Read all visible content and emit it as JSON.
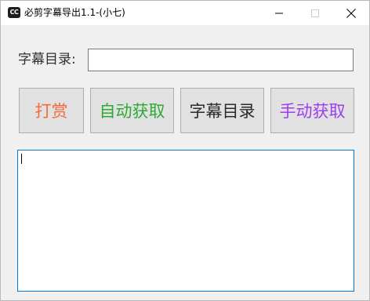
{
  "window": {
    "icon_text": "CC",
    "title": "必剪字幕导出1.1-(小七)"
  },
  "form": {
    "dir_label": "字幕目录:",
    "dir_value": ""
  },
  "buttons": {
    "reward": {
      "label": "打赏",
      "color": "#f26a3c"
    },
    "auto": {
      "label": "自动获取",
      "color": "#2fa836"
    },
    "dir": {
      "label": "字幕目录",
      "color": "#2a2a2a"
    },
    "manual": {
      "label": "手动获取",
      "color": "#9b3ef0"
    }
  },
  "log": {
    "value": ""
  }
}
